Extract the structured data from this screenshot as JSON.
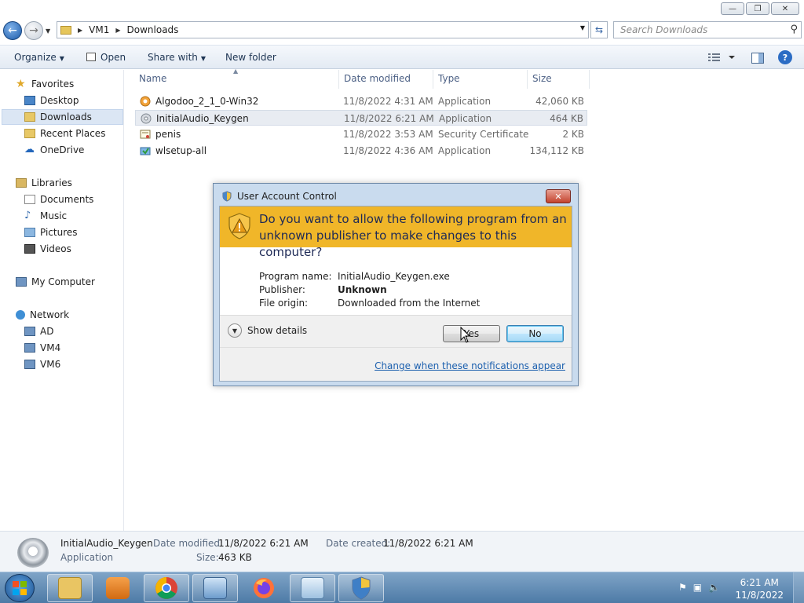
{
  "window": {
    "controls": [
      "minimize",
      "maximize",
      "close"
    ]
  },
  "address": {
    "crumbs": [
      "VM1",
      "Downloads"
    ],
    "search_placeholder": "Search Downloads"
  },
  "toolbar": {
    "organize": "Organize",
    "open": "Open",
    "share_with": "Share with",
    "new_folder": "New folder"
  },
  "sidebar": {
    "favorites": {
      "label": "Favorites",
      "items": [
        "Desktop",
        "Downloads",
        "Recent Places",
        "OneDrive"
      ]
    },
    "libraries": {
      "label": "Libraries",
      "items": [
        "Documents",
        "Music",
        "Pictures",
        "Videos"
      ]
    },
    "computer": {
      "label": "My Computer"
    },
    "network": {
      "label": "Network",
      "items": [
        "AD",
        "VM4",
        "VM6"
      ]
    },
    "selected": "Downloads"
  },
  "columns": {
    "name": "Name",
    "date": "Date modified",
    "type": "Type",
    "size": "Size"
  },
  "files": [
    {
      "name": "Algodoo_2_1_0-Win32",
      "date": "11/8/2022 4:31 AM",
      "type": "Application",
      "size": "42,060 KB"
    },
    {
      "name": "InitialAudio_Keygen",
      "date": "11/8/2022 6:21 AM",
      "type": "Application",
      "size": "464 KB"
    },
    {
      "name": "penis",
      "date": "11/8/2022 3:53 AM",
      "type": "Security Certificate",
      "size": "2 KB"
    },
    {
      "name": "wlsetup-all",
      "date": "11/8/2022 4:36 AM",
      "type": "Application",
      "size": "134,112 KB"
    }
  ],
  "details": {
    "name": "InitialAudio_Keygen",
    "type": "Application",
    "modified_label": "Date modified:",
    "modified": "11/8/2022 6:21 AM",
    "created_label": "Date created:",
    "created": "11/8/2022 6:21 AM",
    "size_label": "Size:",
    "size": "463 KB"
  },
  "uac": {
    "title": "User Account Control",
    "question": "Do you want to allow the following program from an unknown publisher to make changes to this computer?",
    "program_label": "Program name:",
    "program": "InitialAudio_Keygen.exe",
    "publisher_label": "Publisher:",
    "publisher": "Unknown",
    "origin_label": "File origin:",
    "origin": "Downloaded from the Internet",
    "show_details": "Show details",
    "yes": "Yes",
    "no": "No",
    "link": "Change when these notifications appear",
    "banner_color": "#f0b629"
  },
  "taskbar": {
    "apps": [
      "explorer-icon",
      "media-player-icon",
      "chrome-icon",
      "remote-desktop-icon",
      "firefox-icon",
      "notepad-icon",
      "uac-shield-icon"
    ],
    "time": "6:21 AM",
    "date": "11/8/2022"
  }
}
